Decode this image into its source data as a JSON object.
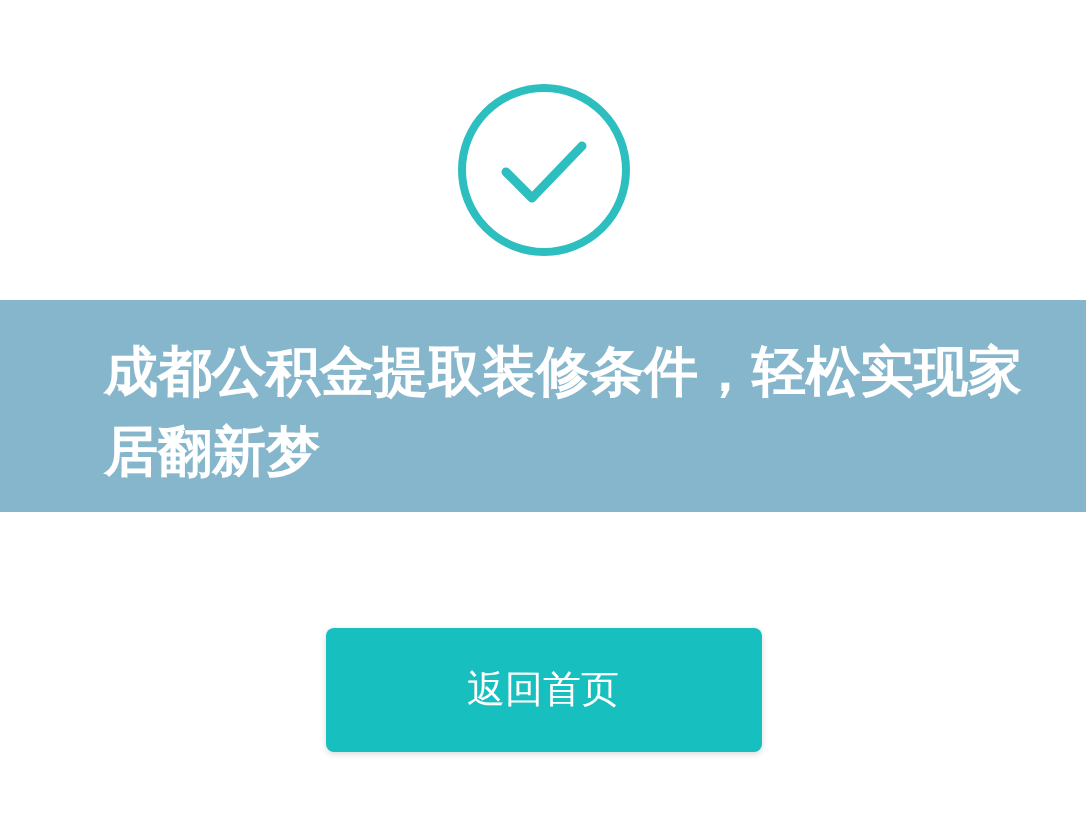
{
  "banner": {
    "title": "成都公积金提取装修条件，轻松实现家居翻新梦"
  },
  "button": {
    "label": "返回首页"
  }
}
